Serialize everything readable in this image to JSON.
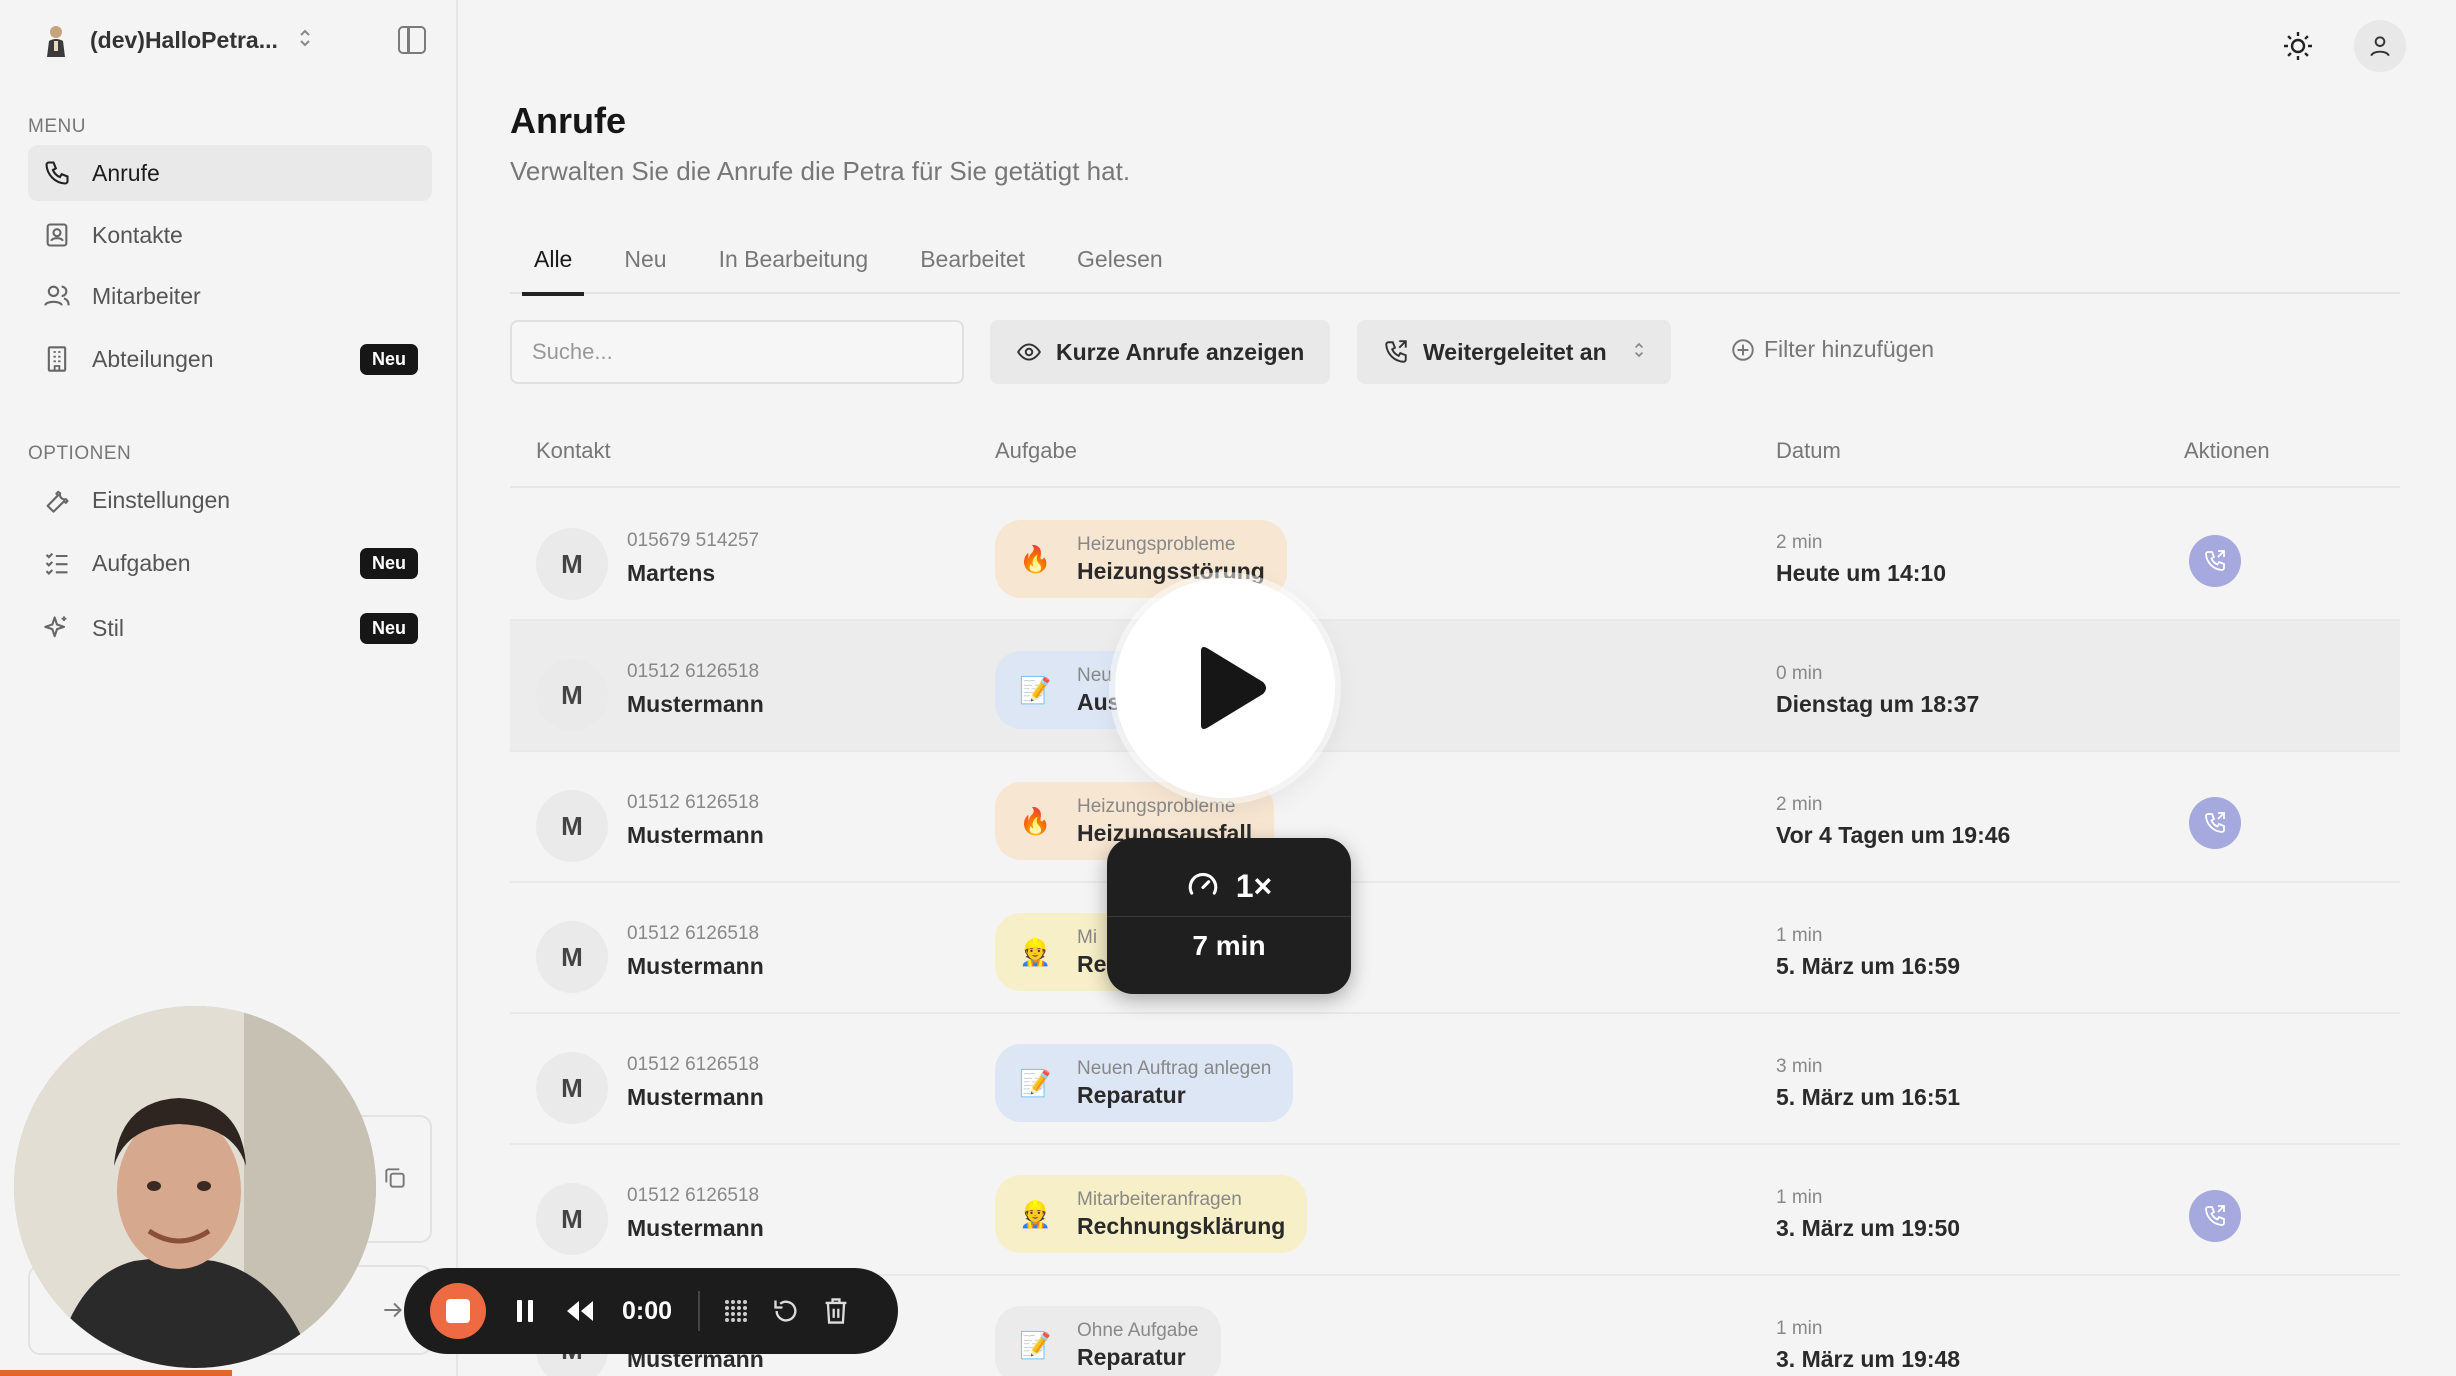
{
  "workspace": {
    "name": "(dev)HalloPetra..."
  },
  "sidebar": {
    "menu_label": "MENU",
    "options_label": "OPTIONEN",
    "items": [
      {
        "label": "Anrufe",
        "icon": "phone-icon",
        "active": true
      },
      {
        "label": "Kontakte",
        "icon": "contact-card-icon"
      },
      {
        "label": "Mitarbeiter",
        "icon": "users-icon"
      },
      {
        "label": "Abteilungen",
        "icon": "building-icon",
        "badge": "Neu"
      }
    ],
    "option_items": [
      {
        "label": "Einstellungen",
        "icon": "wrench-icon"
      },
      {
        "label": "Aufgaben",
        "icon": "checklist-icon",
        "badge": "Neu"
      },
      {
        "label": "Stil",
        "icon": "sparkles-icon",
        "badge": "Neu"
      }
    ]
  },
  "header": {
    "title": "Anrufe",
    "subtitle": "Verwalten Sie die Anrufe die Petra für Sie getätigt hat."
  },
  "tabs": [
    {
      "label": "Alle",
      "active": true
    },
    {
      "label": "Neu"
    },
    {
      "label": "In Bearbeitung"
    },
    {
      "label": "Bearbeitet"
    },
    {
      "label": "Gelesen"
    }
  ],
  "toolbar": {
    "search_placeholder": "Suche...",
    "short_calls_label": "Kurze Anrufe anzeigen",
    "forwarded_label": "Weitergeleitet an",
    "add_filter_label": "Filter hinzufügen"
  },
  "table": {
    "columns": {
      "contact": "Kontakt",
      "task": "Aufgabe",
      "date": "Datum",
      "actions": "Aktionen"
    },
    "rows": [
      {
        "initial": "M",
        "phone": "015679 514257",
        "name": "Martens",
        "task_category": "Heizungsprobleme",
        "task_title": "Heizungsstörung",
        "task_emoji": "🔥",
        "task_color": "orange",
        "duration": "2 min",
        "date": "Heute um 14:10",
        "has_action": true
      },
      {
        "initial": "M",
        "phone": "01512 6126518",
        "name": "Mustermann",
        "task_category": "Neu",
        "task_title": "Aus",
        "task_emoji": "📝",
        "task_color": "blue",
        "duration": "0 min",
        "date": "Dienstag um 18:37",
        "has_action": false
      },
      {
        "initial": "M",
        "phone": "01512 6126518",
        "name": "Mustermann",
        "task_category": "Heizungsprobleme",
        "task_title": "Heizungsausfall",
        "task_emoji": "🔥",
        "task_color": "orange",
        "duration": "2 min",
        "date": "Vor 4 Tagen um 19:46",
        "has_action": true
      },
      {
        "initial": "M",
        "phone": "01512 6126518",
        "name": "Mustermann",
        "task_category": "Mi",
        "task_title": "Re",
        "task_emoji": "👷",
        "task_color": "yellow",
        "duration": "1 min",
        "date": "5. März um 16:59",
        "has_action": false
      },
      {
        "initial": "M",
        "phone": "01512 6126518",
        "name": "Mustermann",
        "task_category": "Neuen Auftrag anlegen",
        "task_title": "Reparatur",
        "task_emoji": "📝",
        "task_color": "blue",
        "duration": "3 min",
        "date": "5. März um 16:51",
        "has_action": false
      },
      {
        "initial": "M",
        "phone": "01512 6126518",
        "name": "Mustermann",
        "task_category": "Mitarbeiteranfragen",
        "task_title": "Rechnungsklärung",
        "task_emoji": "👷",
        "task_color": "yellow",
        "duration": "1 min",
        "date": "3. März um 19:50",
        "has_action": true
      },
      {
        "initial": "M",
        "phone": "",
        "name": "Mustermann",
        "task_category": "Ohne Aufgabe",
        "task_title": "Reparatur",
        "task_emoji": "📝",
        "task_color": "gray",
        "duration": "1 min",
        "date": "3. März um 19:48",
        "has_action": false
      }
    ]
  },
  "player": {
    "speed": "1×",
    "duration": "7 min"
  },
  "recorder": {
    "time": "0:00"
  },
  "colors": {
    "accent_action": "#a6a9dd",
    "record_orange": "#ee6a43",
    "badge_bg": "#161616"
  }
}
